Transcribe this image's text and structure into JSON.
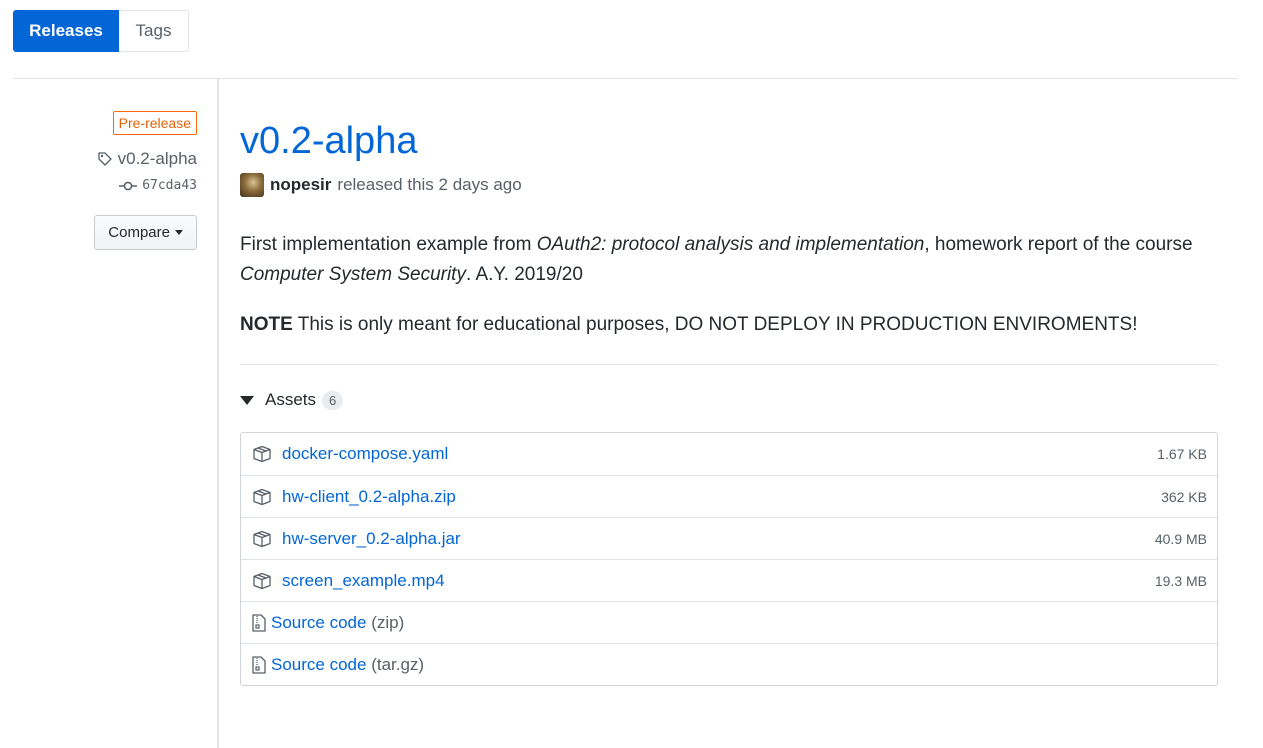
{
  "tabs": [
    {
      "label": "Releases",
      "selected": true
    },
    {
      "label": "Tags",
      "selected": false
    }
  ],
  "sidebar": {
    "badge": "Pre-release",
    "tag": "v0.2-alpha",
    "commit": "67cda43",
    "compare_label": "Compare"
  },
  "release": {
    "title": "v0.2-alpha",
    "author": "nopesir",
    "released_text": "released this 2 days ago",
    "body": {
      "p1_start": "First implementation example from ",
      "p1_em1": "OAuth2: protocol analysis and implementation",
      "p1_mid": ", homework report of the course ",
      "p1_em2": "Computer System Security",
      "p1_end": ". A.Y. 2019/20",
      "note_label": "NOTE",
      "note_text": " This is only meant for educational purposes, DO NOT DEPLOY IN PRODUCTION ENVIROMENTS!"
    }
  },
  "assets": {
    "label": "Assets",
    "count": "6",
    "files": [
      {
        "name": "docker-compose.yaml",
        "size": "1.67 KB",
        "icon": "package-icon"
      },
      {
        "name": "hw-client_0.2-alpha.zip",
        "size": "362 KB",
        "icon": "package-icon"
      },
      {
        "name": "hw-server_0.2-alpha.jar",
        "size": "40.9 MB",
        "icon": "package-icon"
      },
      {
        "name": "screen_example.mp4",
        "size": "19.3 MB",
        "icon": "package-icon"
      }
    ],
    "source": [
      {
        "name": "Source code",
        "ext": "(zip)",
        "icon": "file-zip-icon"
      },
      {
        "name": "Source code",
        "ext": "(tar.gz)",
        "icon": "file-zip-icon"
      }
    ]
  },
  "colors": {
    "accent": "#0366d6",
    "prerelease": "#e36209",
    "muted": "#586069",
    "border": "#e1e4e8"
  }
}
